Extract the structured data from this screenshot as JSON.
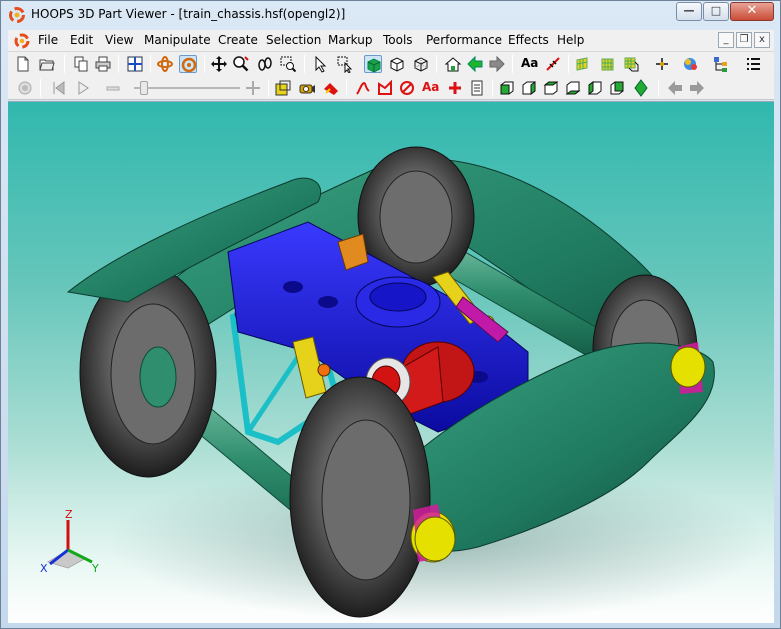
{
  "window": {
    "title": "HOOPS 3D Part Viewer - [train_chassis.hsf(opengl2)]",
    "buttons": {
      "minimize": "—",
      "maximize": "□",
      "close": "✕"
    }
  },
  "menubar": {
    "items": [
      {
        "label": "File"
      },
      {
        "label": "Edit"
      },
      {
        "label": "View"
      },
      {
        "label": "Manipulate"
      },
      {
        "label": "Create"
      },
      {
        "label": "Selection"
      },
      {
        "label": "Markup"
      },
      {
        "label": "Tools"
      },
      {
        "label": "Performance"
      },
      {
        "label": "Effects"
      },
      {
        "label": "Help"
      }
    ],
    "mdi_buttons": {
      "minimize": "_",
      "restore": "❐",
      "close": "x"
    }
  },
  "toolbar1": {
    "text_tool_label": "Aa"
  },
  "toolbar2": {
    "markup_text_label": "Aa"
  },
  "axis_triad": {
    "x": "X",
    "y": "Y",
    "z": "Z"
  },
  "colors": {
    "viewport_top": "#31b8ae",
    "viewport_bottom": "#ffffff",
    "frame_green": "#1f7a5f",
    "bolster_blue": "#1414d8",
    "wheel_gray": "#3f3f3f",
    "bearing_yellow": "#e6e000",
    "bearing_magenta": "#d11c9c",
    "cylinder_red": "#d31212"
  }
}
